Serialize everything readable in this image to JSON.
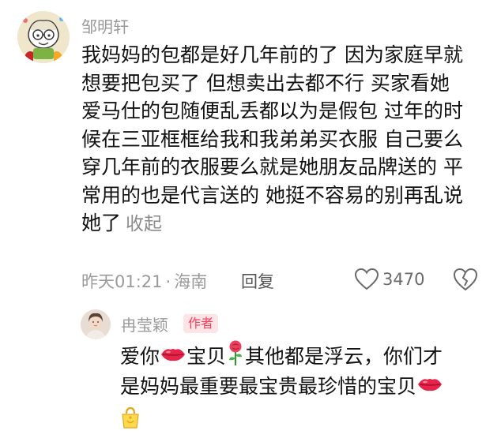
{
  "comment": {
    "username": "邹明轩",
    "lines": [
      "我妈妈的包都是好几年前的了 因为家庭早就",
      "想要把包买了 但想卖出去都不行 买家看她",
      "爱马仕的包随便乱丢都以为是假包 过年的时",
      "候在三亚框框给我和我弟弟买衣服 自己要么",
      "穿几年前的衣服要么就是她朋友品牌送的 平",
      "常用的也是代言送的 她挺不容易的别再乱说",
      "她了"
    ],
    "collapse_label": "收起",
    "time": "昨天01:21",
    "separator": "·",
    "location": "海南",
    "reply_label": "回复",
    "like_count": "3470",
    "icons": {
      "like": "heart-outline-icon",
      "dislike": "broken-heart-outline-icon"
    }
  },
  "reply": {
    "username": "冉莹颖",
    "author_badge": "作者",
    "line1_a": "爱你",
    "line1_b": "宝贝",
    "line1_c": "其他都是浮云，你们才",
    "line2": "是妈妈最重要最宝贵最珍惜的宝贝",
    "emojis": [
      "kiss-lips-emoji",
      "rose-emoji",
      "kiss-lips-emoji",
      "bag-emoji"
    ]
  },
  "colors": {
    "meta_gray": "#9a9a9a",
    "author_red": "#fa3e5a",
    "author_bg": "#fde4e7",
    "lips_red": "#e8234a"
  }
}
